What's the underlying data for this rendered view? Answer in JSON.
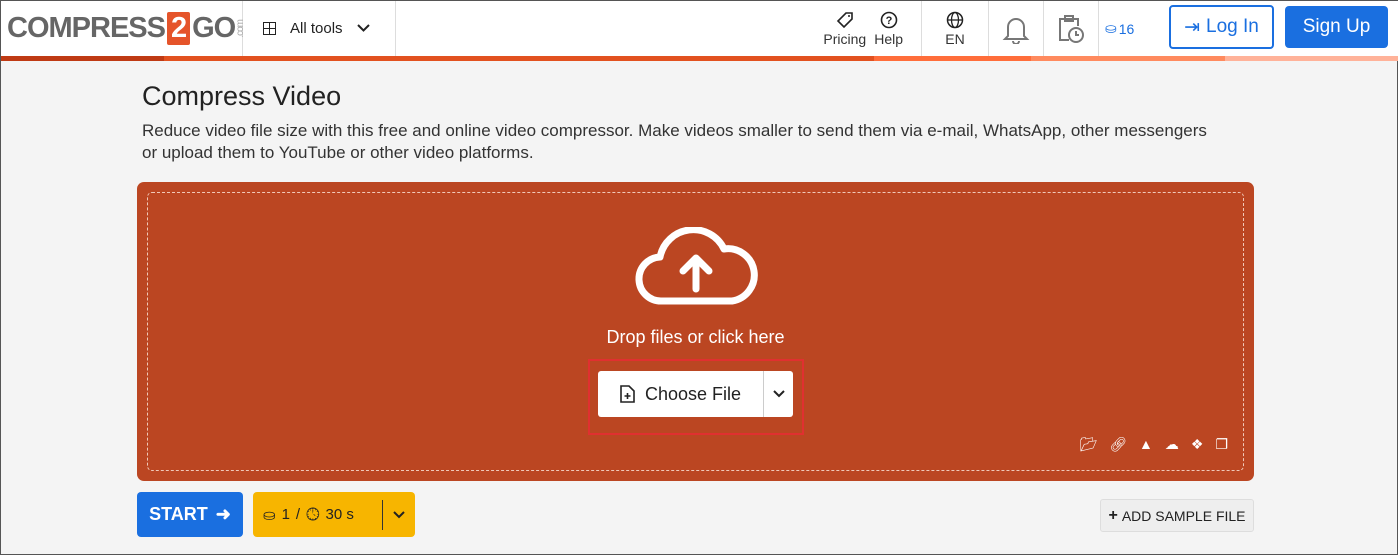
{
  "header": {
    "logo": {
      "left": "COMPRESS",
      "num": "2",
      "right": "GO",
      "suffix": ".com"
    },
    "all_tools": "All tools",
    "pricing": "Pricing",
    "help": "Help",
    "language": "EN",
    "credits": "16",
    "login": "Log In",
    "signup": "Sign Up"
  },
  "main": {
    "title": "Compress Video",
    "description": "Reduce video file size with this free and online video compressor. Make videos smaller to send them via e-mail, WhatsApp, other messengers or upload them to YouTube or other video platforms.",
    "drop_text": "Drop files or click here",
    "choose_file": "Choose File"
  },
  "footer": {
    "start": "START",
    "credit_cost": "1",
    "separator": "/",
    "time": "30 s",
    "add_sample": "ADD SAMPLE FILE"
  },
  "colors": {
    "accent": "#1a6fe0",
    "drop": "#bb4622",
    "credits": "#f7b500"
  }
}
